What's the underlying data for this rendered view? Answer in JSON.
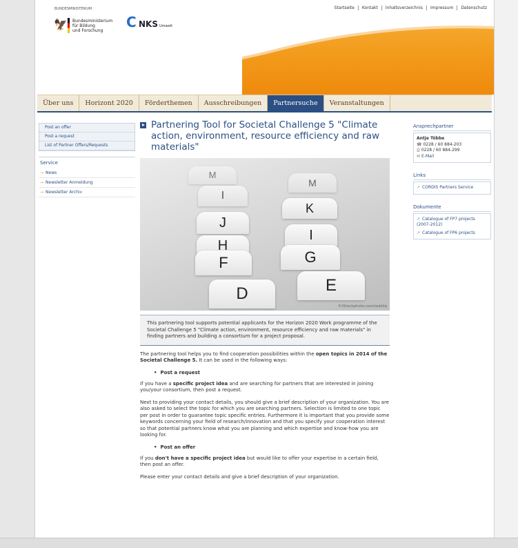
{
  "header": {
    "ministry_small": "BUNDESMINISTERIUM",
    "bmbf_lines": [
      "Bundesministerium",
      "für Bildung",
      "und Forschung"
    ],
    "nks_logo": "NKS",
    "nks_sub": "Umwelt",
    "topnav": [
      "Startseite",
      "Kontakt",
      "Inhaltsverzeichnis",
      "Impressum",
      "Datenschutz"
    ]
  },
  "mainnav": [
    "Über uns",
    "Horizont 2020",
    "Förderthemen",
    "Ausschreibungen",
    "Partnersuche",
    "Veranstaltungen"
  ],
  "active_nav": "Partnersuche",
  "sidebar": {
    "items": [
      "Post an offer",
      "Post a request",
      "List of Partner Offers/Requests"
    ],
    "service_heading": "Service",
    "service_items": [
      "News",
      "Newsletter Anmeldung",
      "Newsletter Archiv"
    ]
  },
  "main": {
    "title": "Partnering Tool for Societal Challenge 5 \"Climate action, environment, resource efficiency and raw materials\"",
    "photo_letters": [
      "M",
      "M",
      "I",
      "K",
      "J",
      "I",
      "H",
      "G",
      "F",
      "D",
      "E"
    ],
    "photo_credit": "©iStockphoto.com/wakila",
    "intro": "This partnering tool supports potential applicants for the Horizon 2020 Work programme of the Societal Challenge 5 \"Climate action, environment, resource efficiency and raw materials\" in finding partners and building a consortium for a project proposal.",
    "p1_a": "The partnering tool helps you to find cooperation possibilities within the ",
    "p1_b": "open topics in 2014 of the Societal Challenge 5.",
    "p1_c": " It can be used in the following ways:",
    "bullet1": "Post a request",
    "p2_a": "If you have a ",
    "p2_b": "specific project idea",
    "p2_c": " and are searching for partners that are interested in joining you/your consortium, then post a request.",
    "p3": "Next to providing your contact details, you should give a brief description of your organization. You are also asked to select the topic for which you are searching partners. Selection is limited to one topic per post in order to guarantee topic specific entries. Furthermore it is important that you provide some keywords concerning your field of research/innovation and that you specify your cooperation interest so that potential partners know what you are planning and which expertise and know-how you are looking for.",
    "bullet2": "Post an offer",
    "p4_a": "If you ",
    "p4_b": "don't have a specific project idea",
    "p4_c": " but would like to offer your expertise in a certain field, then post an offer.",
    "p5": "Please enter your contact details and give a brief description of your organization."
  },
  "right": {
    "contact_heading": "Ansprechpartner",
    "contact_name": "Antje Többe",
    "phone": "0228 / 60 884-203",
    "fax": "0228 / 60 884-299",
    "email": "E-Mail",
    "links_heading": "Links",
    "links": [
      "CORDIS Partners Service"
    ],
    "docs_heading": "Dokumente",
    "docs": [
      "Catalogue of FP7 projects (2007-2012)",
      "Catalogue of FP6 projects"
    ]
  },
  "colors": {
    "accent": "#2b4f83",
    "orange": "#f39a1b"
  }
}
